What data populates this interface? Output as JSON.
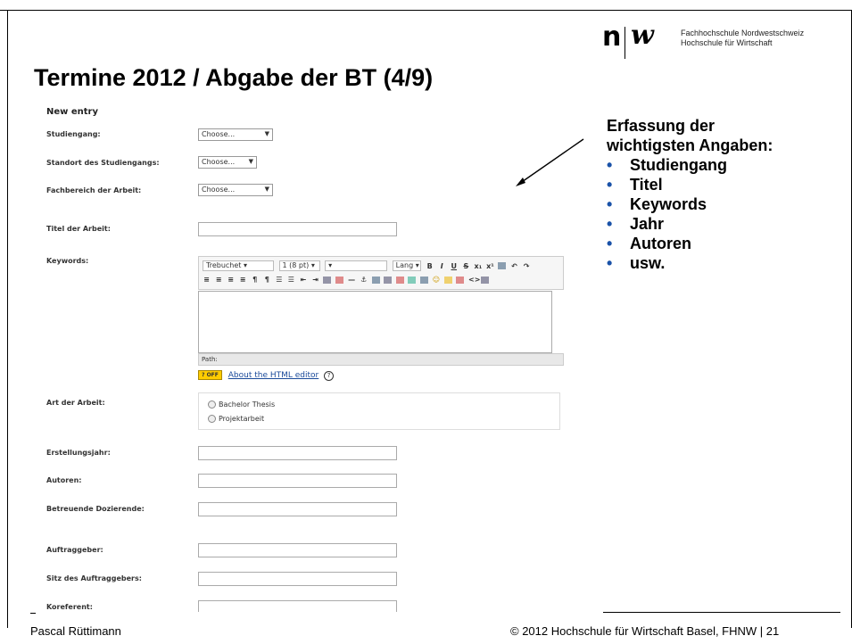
{
  "logo": {
    "line1": "Fachhochschule Nordwestschweiz",
    "line2": "Hochschule für Wirtschaft"
  },
  "title": "Termine 2012 / Abgabe der BT (4/9)",
  "form": {
    "heading": "New entry",
    "fields": {
      "studiengang": {
        "label": "Studiengang:",
        "value": "Choose..."
      },
      "standort": {
        "label": "Standort des Studiengangs:",
        "value": "Choose..."
      },
      "fachbereich": {
        "label": "Fachbereich der Arbeit:",
        "value": "Choose..."
      },
      "titel": {
        "label": "Titel der Arbeit:"
      },
      "keywords": {
        "label": "Keywords:"
      },
      "art": {
        "label": "Art der Arbeit:"
      },
      "erstellungsjahr": {
        "label": "Erstellungsjahr:"
      },
      "autoren": {
        "label": "Autoren:"
      },
      "dozierende": {
        "label": "Betreuende Dozierende:"
      },
      "auftraggeber": {
        "label": "Auftraggeber:"
      },
      "sitz": {
        "label": "Sitz des Auftraggebers:"
      },
      "koreferent": {
        "label": "Koreferent:"
      }
    },
    "editor": {
      "font": "Trebuchet",
      "size": "1 (8 pt)",
      "lang": "Lang",
      "path_label": "Path:",
      "help_badge": "? OFF",
      "help_link": "About the HTML editor"
    },
    "radio_options": [
      "Bachelor Thesis",
      "Projektarbeit"
    ]
  },
  "callout": {
    "heading_line1": "Erfassung der",
    "heading_line2": "wichtigsten Angaben:",
    "items": [
      "Studiengang",
      "Titel",
      "Keywords",
      "Jahr",
      "Autoren",
      "usw."
    ],
    "bullet_color": "#1a52a8"
  },
  "footer": {
    "author": "Pascal Rüttimann",
    "copyright": "© 2012 Hochschule für Wirtschaft Basel, FHNW | 21"
  }
}
